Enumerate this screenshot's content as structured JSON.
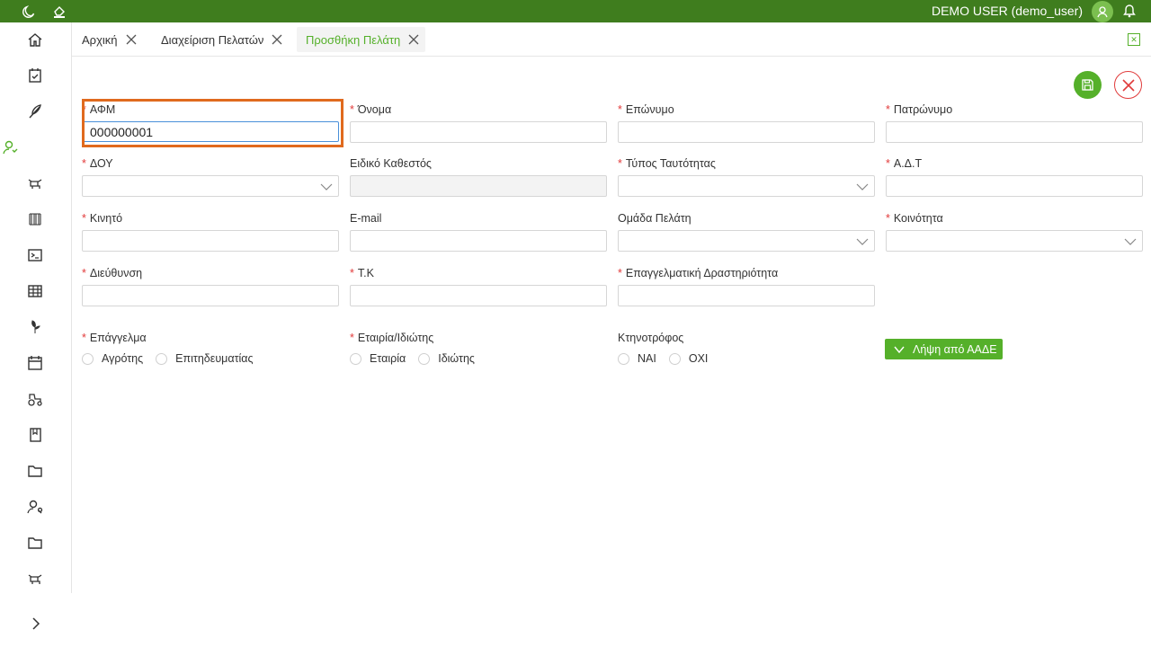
{
  "topbar": {
    "user_label": "DEMO USER (demo_user)",
    "icons": [
      "moon-icon",
      "paint-bucket-icon",
      "avatar-icon",
      "bell-icon"
    ]
  },
  "sidebar": {
    "items": [
      "home-icon",
      "calendar-check-icon",
      "feather-icon",
      "user-icon",
      "cow-icon",
      "barcode-icon",
      "terminal-icon",
      "table-icon",
      "leaf-icon",
      "calendar-icon",
      "tractor-icon",
      "book-icon",
      "folder-icon",
      "user-search-icon",
      "folder-icon",
      "cow-icon"
    ],
    "expand_icon": "chevron-right-icon"
  },
  "tabs": [
    {
      "label": "Αρχική",
      "active": false
    },
    {
      "label": "Διαχείριση Πελατών",
      "active": false
    },
    {
      "label": "Προσθήκη Πελάτη",
      "active": true
    }
  ],
  "form": {
    "afm": {
      "label": "ΑΦΜ",
      "value": "000000001",
      "required": true
    },
    "onoma": {
      "label": "Όνομα",
      "value": "",
      "required": true
    },
    "eponymo": {
      "label": "Επώνυμο",
      "value": "",
      "required": true
    },
    "patronymo": {
      "label": "Πατρώνυμο",
      "value": "",
      "required": true
    },
    "doy": {
      "label": "ΔΟΥ",
      "value": "",
      "required": true
    },
    "eidiko": {
      "label": "Ειδικό Καθεστός",
      "value": "",
      "required": false
    },
    "typos": {
      "label": "Τύπος Ταυτότητας",
      "value": "",
      "required": true
    },
    "adt": {
      "label": "Α.Δ.Τ",
      "value": "",
      "required": true
    },
    "kinito": {
      "label": "Κινητό",
      "value": "",
      "required": true
    },
    "email": {
      "label": "E-mail",
      "value": "",
      "required": false
    },
    "omada": {
      "label": "Ομάδα Πελάτη",
      "value": "",
      "required": false
    },
    "koinotita": {
      "label": "Κοινότητα",
      "value": "",
      "required": true
    },
    "dieuthynsi": {
      "label": "Διεύθυνση",
      "value": "",
      "required": true
    },
    "tk": {
      "label": "Τ.Κ",
      "value": "",
      "required": true
    },
    "drastiriotita": {
      "label": "Επαγγελματική Δραστηριότητα",
      "value": "",
      "required": true
    }
  },
  "radios": {
    "epaggelma": {
      "label": "Επάγγελμα",
      "options": [
        "Αγρότης",
        "Επιτηδευματίας"
      ]
    },
    "etairia": {
      "label": "Εταιρία/Ιδιώτης",
      "options": [
        "Εταιρία",
        "Ιδιώτης"
      ]
    },
    "ktinotrofos": {
      "label": "Κτηνοτρόφος",
      "options": [
        "ΝΑΙ",
        "ΟΧΙ"
      ]
    }
  },
  "buttons": {
    "aade_label": "Λήψη από ΑΑΔΕ"
  },
  "colors": {
    "topbar": "#3f7d1e",
    "accent": "#55b02a",
    "danger": "#e03b3b",
    "highlight": "#e06a1e"
  }
}
